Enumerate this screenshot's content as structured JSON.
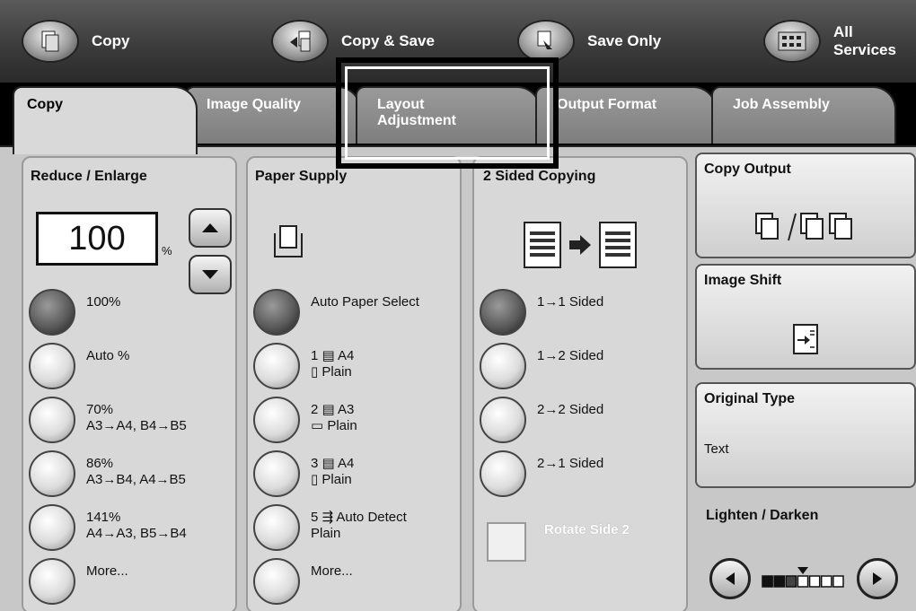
{
  "services": [
    {
      "label": "Copy",
      "icon": "copy-icon"
    },
    {
      "label": "Copy & Save",
      "icon": "copy-save-icon"
    },
    {
      "label": "Save Only",
      "icon": "save-only-icon"
    },
    {
      "label": "All\nServices",
      "icon": "all-services-icon"
    }
  ],
  "tabs": [
    {
      "label": "Copy",
      "active": true
    },
    {
      "label": "Image Quality",
      "active": false
    },
    {
      "label": "Layout\nAdjustment",
      "active": false
    },
    {
      "label": "Output Format",
      "active": false
    },
    {
      "label": "Job Assembly",
      "active": false
    }
  ],
  "reduce_enlarge": {
    "title": "Reduce / Enlarge",
    "value": "100",
    "unit": "%",
    "options": [
      {
        "label": "100%",
        "selected": true
      },
      {
        "label": "Auto %",
        "selected": false
      },
      {
        "label": "70%\nA3→A4, B4→B5",
        "selected": false
      },
      {
        "label": "86%\nA3→B4, A4→B5",
        "selected": false
      },
      {
        "label": "141%\nA4→A3, B5→B4",
        "selected": false
      },
      {
        "label": "More...",
        "selected": false
      }
    ]
  },
  "paper_supply": {
    "title": "Paper Supply",
    "options": [
      {
        "label": "Auto Paper Select",
        "selected": true
      },
      {
        "label": "1 ▤ A4\n▯ Plain",
        "selected": false
      },
      {
        "label": "2 ▤ A3\n▭ Plain",
        "selected": false
      },
      {
        "label": "3 ▤ A4\n▯ Plain",
        "selected": false
      },
      {
        "label": "5 ⇶ Auto Detect\n    Plain",
        "selected": false
      },
      {
        "label": "More...",
        "selected": false
      }
    ]
  },
  "two_sided": {
    "title": "2 Sided Copying",
    "options": [
      {
        "label": "1→1 Sided",
        "selected": true
      },
      {
        "label": "1→2 Sided",
        "selected": false
      },
      {
        "label": "2→2 Sided",
        "selected": false
      },
      {
        "label": "2→1 Sided",
        "selected": false
      }
    ],
    "rotate_label": "Rotate Side 2"
  },
  "right_buttons": {
    "copy_output": {
      "title": "Copy Output"
    },
    "image_shift": {
      "title": "Image Shift"
    },
    "original_type": {
      "title": "Original Type",
      "value": "Text"
    }
  },
  "lighten_darken": {
    "title": "Lighten / Darken",
    "level": 3,
    "levels": 7
  }
}
